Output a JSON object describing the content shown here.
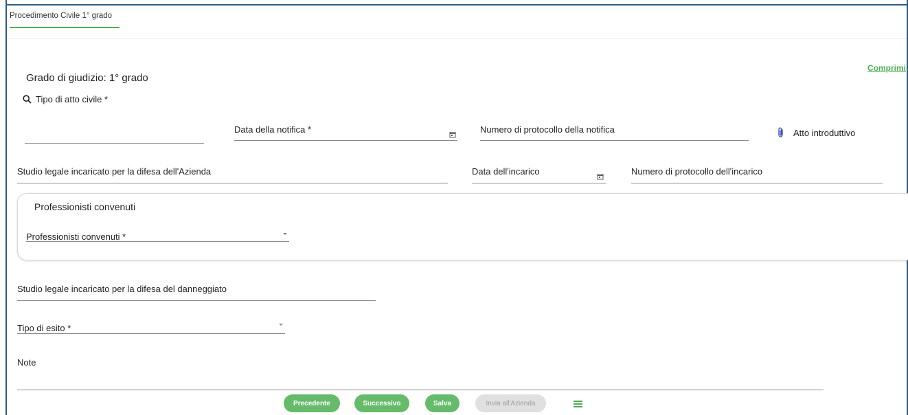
{
  "tab": {
    "label": "Procedimento Civile 1° grado"
  },
  "collapse_label": "Comprimi",
  "heading": "Grado di giudizio: 1° grado",
  "search": {
    "label": "Tipo di atto civile *"
  },
  "fields": {
    "data_notifica": "Data della notifica *",
    "protocollo_notifica": "Numero di protocollo della notifica",
    "atto_introduttivo": "Atto introduttivo",
    "studio_azienda": "Studio legale incaricato per la difesa dell'Azienda",
    "data_incarico": "Data dell'incarico",
    "protocollo_incarico": "Numero di protocollo dell'incarico",
    "studio_danneggiato": "Studio legale incaricato per la difesa del danneggiato",
    "tipo_esito": "Tipo di esito *",
    "note": "Note"
  },
  "professionisti": {
    "title": "Professionisti convenuti",
    "select_label": "Professionisti convenuti *"
  },
  "buttons": {
    "precedente": "Precedente",
    "successivo": "Successivo",
    "salva": "Salva",
    "invia": "Invia all'Azienda"
  },
  "colors": {
    "accent": "#66bb6a",
    "frame": "#2b5a86",
    "link": "#4caf50"
  }
}
